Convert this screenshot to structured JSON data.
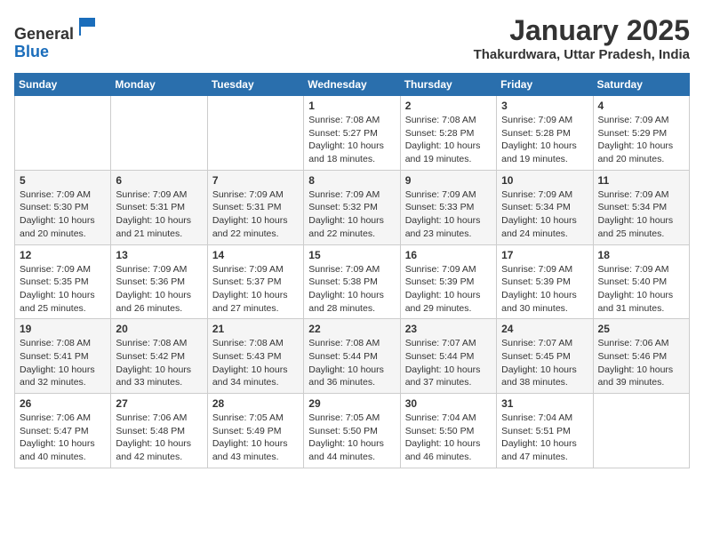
{
  "header": {
    "logo_line1": "General",
    "logo_line2": "Blue",
    "month_title": "January 2025",
    "location": "Thakurdwara, Uttar Pradesh, India"
  },
  "days_of_week": [
    "Sunday",
    "Monday",
    "Tuesday",
    "Wednesday",
    "Thursday",
    "Friday",
    "Saturday"
  ],
  "weeks": [
    [
      {
        "day": "",
        "sunrise": "",
        "sunset": "",
        "daylight": ""
      },
      {
        "day": "",
        "sunrise": "",
        "sunset": "",
        "daylight": ""
      },
      {
        "day": "",
        "sunrise": "",
        "sunset": "",
        "daylight": ""
      },
      {
        "day": "1",
        "sunrise": "Sunrise: 7:08 AM",
        "sunset": "Sunset: 5:27 PM",
        "daylight": "Daylight: 10 hours and 18 minutes."
      },
      {
        "day": "2",
        "sunrise": "Sunrise: 7:08 AM",
        "sunset": "Sunset: 5:28 PM",
        "daylight": "Daylight: 10 hours and 19 minutes."
      },
      {
        "day": "3",
        "sunrise": "Sunrise: 7:09 AM",
        "sunset": "Sunset: 5:28 PM",
        "daylight": "Daylight: 10 hours and 19 minutes."
      },
      {
        "day": "4",
        "sunrise": "Sunrise: 7:09 AM",
        "sunset": "Sunset: 5:29 PM",
        "daylight": "Daylight: 10 hours and 20 minutes."
      }
    ],
    [
      {
        "day": "5",
        "sunrise": "Sunrise: 7:09 AM",
        "sunset": "Sunset: 5:30 PM",
        "daylight": "Daylight: 10 hours and 20 minutes."
      },
      {
        "day": "6",
        "sunrise": "Sunrise: 7:09 AM",
        "sunset": "Sunset: 5:31 PM",
        "daylight": "Daylight: 10 hours and 21 minutes."
      },
      {
        "day": "7",
        "sunrise": "Sunrise: 7:09 AM",
        "sunset": "Sunset: 5:31 PM",
        "daylight": "Daylight: 10 hours and 22 minutes."
      },
      {
        "day": "8",
        "sunrise": "Sunrise: 7:09 AM",
        "sunset": "Sunset: 5:32 PM",
        "daylight": "Daylight: 10 hours and 22 minutes."
      },
      {
        "day": "9",
        "sunrise": "Sunrise: 7:09 AM",
        "sunset": "Sunset: 5:33 PM",
        "daylight": "Daylight: 10 hours and 23 minutes."
      },
      {
        "day": "10",
        "sunrise": "Sunrise: 7:09 AM",
        "sunset": "Sunset: 5:34 PM",
        "daylight": "Daylight: 10 hours and 24 minutes."
      },
      {
        "day": "11",
        "sunrise": "Sunrise: 7:09 AM",
        "sunset": "Sunset: 5:34 PM",
        "daylight": "Daylight: 10 hours and 25 minutes."
      }
    ],
    [
      {
        "day": "12",
        "sunrise": "Sunrise: 7:09 AM",
        "sunset": "Sunset: 5:35 PM",
        "daylight": "Daylight: 10 hours and 25 minutes."
      },
      {
        "day": "13",
        "sunrise": "Sunrise: 7:09 AM",
        "sunset": "Sunset: 5:36 PM",
        "daylight": "Daylight: 10 hours and 26 minutes."
      },
      {
        "day": "14",
        "sunrise": "Sunrise: 7:09 AM",
        "sunset": "Sunset: 5:37 PM",
        "daylight": "Daylight: 10 hours and 27 minutes."
      },
      {
        "day": "15",
        "sunrise": "Sunrise: 7:09 AM",
        "sunset": "Sunset: 5:38 PM",
        "daylight": "Daylight: 10 hours and 28 minutes."
      },
      {
        "day": "16",
        "sunrise": "Sunrise: 7:09 AM",
        "sunset": "Sunset: 5:39 PM",
        "daylight": "Daylight: 10 hours and 29 minutes."
      },
      {
        "day": "17",
        "sunrise": "Sunrise: 7:09 AM",
        "sunset": "Sunset: 5:39 PM",
        "daylight": "Daylight: 10 hours and 30 minutes."
      },
      {
        "day": "18",
        "sunrise": "Sunrise: 7:09 AM",
        "sunset": "Sunset: 5:40 PM",
        "daylight": "Daylight: 10 hours and 31 minutes."
      }
    ],
    [
      {
        "day": "19",
        "sunrise": "Sunrise: 7:08 AM",
        "sunset": "Sunset: 5:41 PM",
        "daylight": "Daylight: 10 hours and 32 minutes."
      },
      {
        "day": "20",
        "sunrise": "Sunrise: 7:08 AM",
        "sunset": "Sunset: 5:42 PM",
        "daylight": "Daylight: 10 hours and 33 minutes."
      },
      {
        "day": "21",
        "sunrise": "Sunrise: 7:08 AM",
        "sunset": "Sunset: 5:43 PM",
        "daylight": "Daylight: 10 hours and 34 minutes."
      },
      {
        "day": "22",
        "sunrise": "Sunrise: 7:08 AM",
        "sunset": "Sunset: 5:44 PM",
        "daylight": "Daylight: 10 hours and 36 minutes."
      },
      {
        "day": "23",
        "sunrise": "Sunrise: 7:07 AM",
        "sunset": "Sunset: 5:44 PM",
        "daylight": "Daylight: 10 hours and 37 minutes."
      },
      {
        "day": "24",
        "sunrise": "Sunrise: 7:07 AM",
        "sunset": "Sunset: 5:45 PM",
        "daylight": "Daylight: 10 hours and 38 minutes."
      },
      {
        "day": "25",
        "sunrise": "Sunrise: 7:06 AM",
        "sunset": "Sunset: 5:46 PM",
        "daylight": "Daylight: 10 hours and 39 minutes."
      }
    ],
    [
      {
        "day": "26",
        "sunrise": "Sunrise: 7:06 AM",
        "sunset": "Sunset: 5:47 PM",
        "daylight": "Daylight: 10 hours and 40 minutes."
      },
      {
        "day": "27",
        "sunrise": "Sunrise: 7:06 AM",
        "sunset": "Sunset: 5:48 PM",
        "daylight": "Daylight: 10 hours and 42 minutes."
      },
      {
        "day": "28",
        "sunrise": "Sunrise: 7:05 AM",
        "sunset": "Sunset: 5:49 PM",
        "daylight": "Daylight: 10 hours and 43 minutes."
      },
      {
        "day": "29",
        "sunrise": "Sunrise: 7:05 AM",
        "sunset": "Sunset: 5:50 PM",
        "daylight": "Daylight: 10 hours and 44 minutes."
      },
      {
        "day": "30",
        "sunrise": "Sunrise: 7:04 AM",
        "sunset": "Sunset: 5:50 PM",
        "daylight": "Daylight: 10 hours and 46 minutes."
      },
      {
        "day": "31",
        "sunrise": "Sunrise: 7:04 AM",
        "sunset": "Sunset: 5:51 PM",
        "daylight": "Daylight: 10 hours and 47 minutes."
      },
      {
        "day": "",
        "sunrise": "",
        "sunset": "",
        "daylight": ""
      }
    ]
  ]
}
